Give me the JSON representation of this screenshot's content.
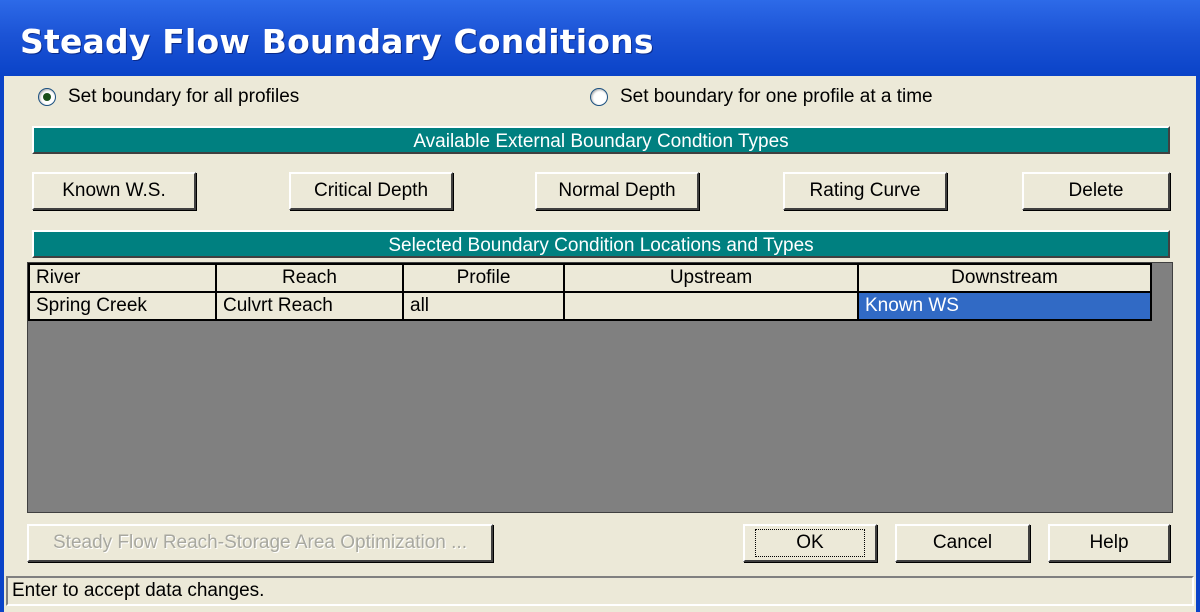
{
  "window": {
    "title": "Steady Flow Boundary Conditions"
  },
  "options": {
    "all_profiles": {
      "label": "Set boundary for all profiles",
      "checked": true
    },
    "one_profile": {
      "label": "Set boundary for one profile at a time",
      "checked": false
    }
  },
  "types_section": {
    "header": "Available External Boundary Condtion Types",
    "buttons": {
      "known_ws": "Known W.S.",
      "critical_depth": "Critical Depth",
      "normal_depth": "Normal Depth",
      "rating_curve": "Rating Curve",
      "delete": "Delete"
    }
  },
  "locations_section": {
    "header": "Selected Boundary Condition Locations and Types",
    "columns": [
      "River",
      "Reach",
      "Profile",
      "Upstream",
      "Downstream"
    ],
    "rows": [
      {
        "river": "Spring Creek",
        "reach": "Culvrt Reach",
        "profile": "all",
        "upstream": "",
        "downstream": "Known WS"
      }
    ]
  },
  "footer": {
    "optimization": "Steady Flow Reach-Storage Area Optimization ...",
    "ok": "OK",
    "cancel": "Cancel",
    "help": "Help"
  },
  "status": "Enter to accept data changes.",
  "colors": {
    "title_bar": "#0a43c8",
    "banner": "#008080",
    "selection": "#316ac5"
  }
}
